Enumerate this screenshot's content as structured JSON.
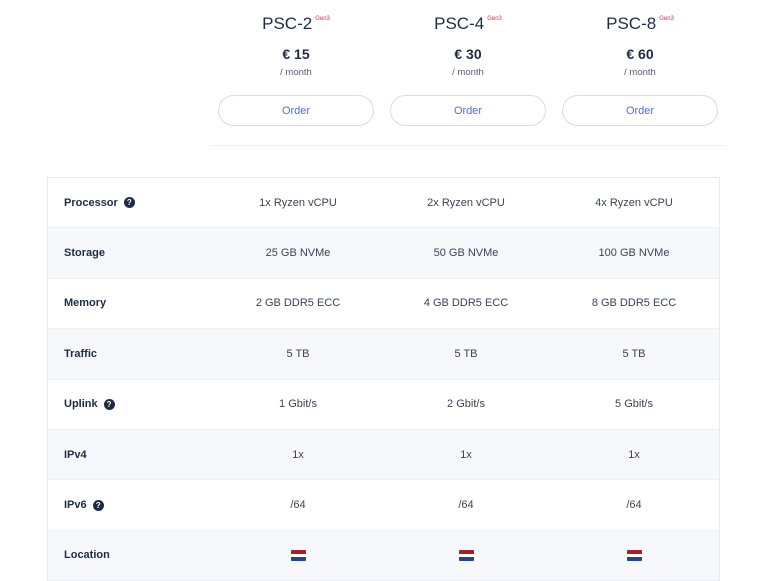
{
  "plans": [
    {
      "name": "PSC-2",
      "badge": "Gen3",
      "price": "€ 15",
      "period": "/ month",
      "order_label": "Order"
    },
    {
      "name": "PSC-4",
      "badge": "Gen3",
      "price": "€ 30",
      "period": "/ month",
      "order_label": "Order"
    },
    {
      "name": "PSC-8",
      "badge": "Gen3",
      "price": "€ 60",
      "period": "/ month",
      "order_label": "Order"
    }
  ],
  "specs": [
    {
      "label": "Processor",
      "help": "?",
      "values": [
        "1x Ryzen vCPU",
        "2x Ryzen vCPU",
        "4x Ryzen vCPU"
      ]
    },
    {
      "label": "Storage",
      "values": [
        "25 GB NVMe",
        "50 GB NVMe",
        "100 GB NVMe"
      ]
    },
    {
      "label": "Memory",
      "values": [
        "2 GB DDR5 ECC",
        "4 GB DDR5 ECC",
        "8 GB DDR5 ECC"
      ]
    },
    {
      "label": "Traffic",
      "values": [
        "5 TB",
        "5 TB",
        "5 TB"
      ]
    },
    {
      "label": "Uplink",
      "help": "?",
      "values": [
        "1 Gbit/s",
        "2 Gbit/s",
        "5 Gbit/s"
      ]
    },
    {
      "label": "IPv4",
      "values": [
        "1x",
        "1x",
        "1x"
      ]
    },
    {
      "label": "IPv6",
      "help": "?",
      "values": [
        "/64",
        "/64",
        "/64"
      ]
    },
    {
      "label": "Location",
      "values": [
        "netherlands-flag-icon",
        "netherlands-flag-icon",
        "netherlands-flag-icon"
      ]
    }
  ],
  "colors": {
    "accent": "#4a6fe0",
    "badge": "#e0245e",
    "text": "#1f2a44",
    "row_alt": "#f6f8fb",
    "flag": [
      "#ae1c28",
      "#ffffff",
      "#21468b"
    ]
  }
}
